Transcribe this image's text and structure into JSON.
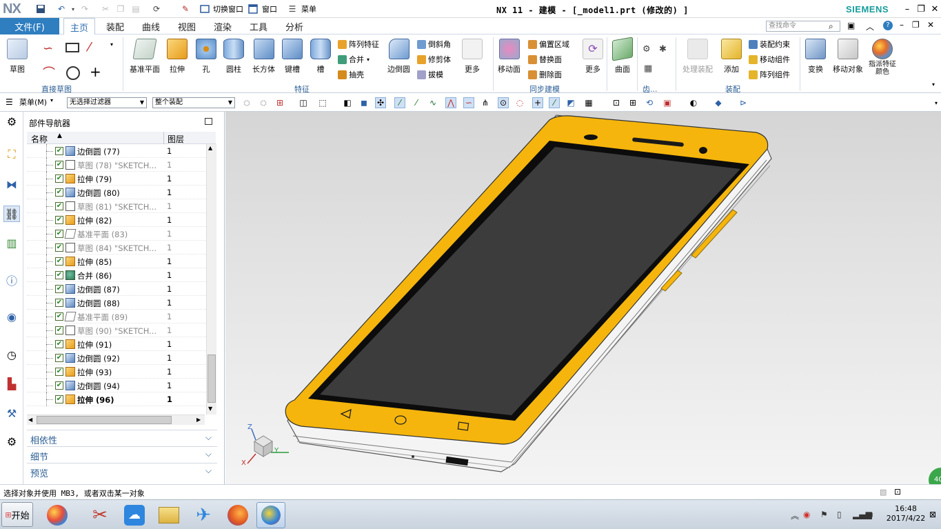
{
  "titlebar": {
    "logo": "NX",
    "switch_window": "切换窗口",
    "window_menu": "窗口",
    "menu_label": "菜单",
    "title": "NX 11 - 建模 - [_model1.prt  (修改的) ]",
    "brand": "SIEMENS"
  },
  "ribbon_tabs": {
    "file": "文件(F)",
    "tabs": [
      "主页",
      "装配",
      "曲线",
      "视图",
      "渲染",
      "工具",
      "分析"
    ],
    "active": "主页",
    "search_placeholder": "查找命令"
  },
  "ribbon": {
    "sketch": "草图",
    "direct_sketch_group": "直接草图",
    "datum_plane": "基准平面",
    "extrude": "拉伸",
    "hole": "孔",
    "cylinder": "圆柱",
    "block": "长方体",
    "boss": "键槽",
    "groove": "槽",
    "pattern_feature": "阵列特征",
    "unite": "合并",
    "shell": "抽壳",
    "edge_blend": "边倒圆",
    "chamfer": "倒斜角",
    "trim_body": "修剪体",
    "draft": "拔模",
    "more1": "更多",
    "feature_group": "特征",
    "move_face": "移动面",
    "offset_region": "偏置区域",
    "replace_face": "替换面",
    "delete_face": "删除面",
    "more2": "更多",
    "sync_group": "同步建模",
    "surface": "曲面",
    "gear_group": "齿...",
    "process_assembly": "处理装配",
    "add": "添加",
    "assembly_constraint": "装配约束",
    "move_component": "移动组件",
    "pattern_component": "阵列组件",
    "assembly_group": "装配",
    "transform": "变换",
    "move_object": "移动对象",
    "smart_color": "指派特征颜色"
  },
  "toolbar": {
    "menu": "菜单(M)",
    "filter": "无选择过滤器",
    "scope": "整个装配"
  },
  "navigator": {
    "title": "部件导航器",
    "col_name": "名称",
    "col_layer": "图层",
    "rows": [
      {
        "name": "边倒圆  (77)",
        "layer": "1",
        "icon": "edge-blend",
        "state": "normal"
      },
      {
        "name": "草图  (78) \"SKETCH...",
        "layer": "1",
        "icon": "sketch",
        "state": "grey"
      },
      {
        "name": "拉伸  (79)",
        "layer": "1",
        "icon": "extrude",
        "state": "normal"
      },
      {
        "name": "边倒圆  (80)",
        "layer": "1",
        "icon": "edge-blend",
        "state": "normal"
      },
      {
        "name": "草图  (81) \"SKETCH...",
        "layer": "1",
        "icon": "sketch",
        "state": "grey"
      },
      {
        "name": "拉伸  (82)",
        "layer": "1",
        "icon": "extrude",
        "state": "normal"
      },
      {
        "name": "基准平面  (83)",
        "layer": "1",
        "icon": "datum",
        "state": "grey"
      },
      {
        "name": "草图  (84) \"SKETCH...",
        "layer": "1",
        "icon": "sketch",
        "state": "grey"
      },
      {
        "name": "拉伸  (85)",
        "layer": "1",
        "icon": "extrude",
        "state": "normal"
      },
      {
        "name": "合并  (86)",
        "layer": "1",
        "icon": "unite",
        "state": "normal"
      },
      {
        "name": "边倒圆  (87)",
        "layer": "1",
        "icon": "edge-blend",
        "state": "normal"
      },
      {
        "name": "边倒圆  (88)",
        "layer": "1",
        "icon": "edge-blend",
        "state": "normal"
      },
      {
        "name": "基准平面  (89)",
        "layer": "1",
        "icon": "datum",
        "state": "grey"
      },
      {
        "name": "草图  (90) \"SKETCH...",
        "layer": "1",
        "icon": "sketch",
        "state": "grey"
      },
      {
        "name": "拉伸  (91)",
        "layer": "1",
        "icon": "extrude",
        "state": "normal"
      },
      {
        "name": "边倒圆  (92)",
        "layer": "1",
        "icon": "edge-blend",
        "state": "normal"
      },
      {
        "name": "拉伸  (93)",
        "layer": "1",
        "icon": "extrude",
        "state": "normal"
      },
      {
        "name": "边倒圆  (94)",
        "layer": "1",
        "icon": "edge-blend",
        "state": "normal"
      },
      {
        "name": "拉伸  (96)",
        "layer": "1",
        "icon": "extrude",
        "state": "bold"
      }
    ],
    "panels": [
      "相依性",
      "细节",
      "预览"
    ]
  },
  "triad": {
    "z": "Z",
    "y": "Y",
    "x": "X"
  },
  "status": {
    "text": "选择对象并使用 MB3, 或者双击某一对象"
  },
  "taskbar": {
    "start": "开始",
    "time": "16:48",
    "date": "2017/4/22",
    "badge": "40"
  },
  "colors": {
    "accent": "#2e7ec0",
    "phone_frame": "#f5b50c",
    "screen": "#3c3c3c"
  }
}
